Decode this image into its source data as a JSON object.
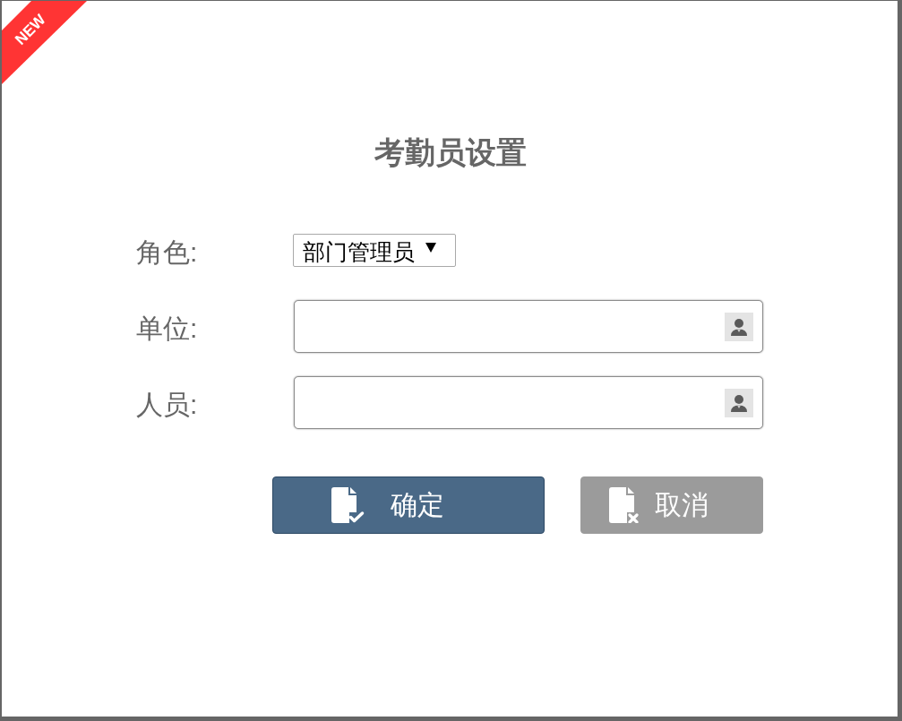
{
  "badge": {
    "text": "NEW"
  },
  "title": "考勤员设置",
  "form": {
    "fields": [
      {
        "kind": "select",
        "label": "角色:",
        "value": "部门管理员"
      },
      {
        "kind": "picker",
        "label": "单位:"
      },
      {
        "kind": "picker",
        "label": "人员:"
      }
    ]
  },
  "buttons": [
    {
      "kind": "primary",
      "label": "确定"
    },
    {
      "kind": "secondary",
      "label": "取消"
    }
  ]
}
